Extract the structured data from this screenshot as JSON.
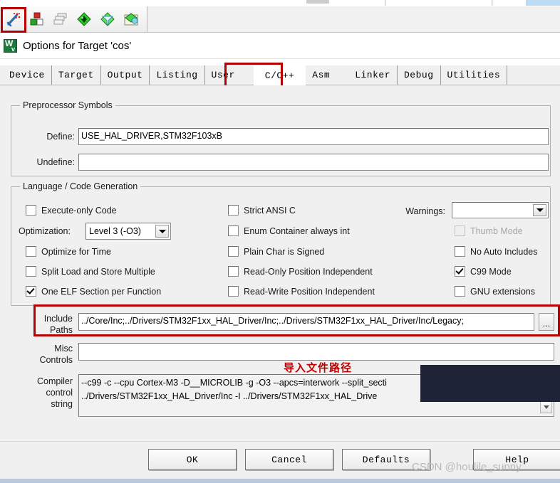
{
  "toolbar": {
    "buttons": [
      {
        "name": "target-options-magic-wand",
        "title": "Options for Target",
        "enabled": true
      },
      {
        "name": "build-target",
        "title": "Build",
        "enabled": true
      },
      {
        "name": "batch-build",
        "title": "Batch Build",
        "enabled": false
      },
      {
        "name": "manage-project-items",
        "title": "Manage Project Items",
        "enabled": true
      },
      {
        "name": "configuration-wizard",
        "title": "Configuration Wizard",
        "enabled": true
      },
      {
        "name": "pack-installer",
        "title": "Pack Installer",
        "enabled": true
      }
    ]
  },
  "dialog": {
    "title": "Options for Target 'cos'",
    "icon": "keil-uvision-icon"
  },
  "tabs": [
    {
      "label": "Device",
      "active": false
    },
    {
      "label": "Target",
      "active": false
    },
    {
      "label": "Output",
      "active": false
    },
    {
      "label": "Listing",
      "active": false
    },
    {
      "label": "User",
      "active": false
    },
    {
      "label": "C/C++",
      "active": true
    },
    {
      "label": "Asm",
      "active": false
    },
    {
      "label": "Linker",
      "active": false
    },
    {
      "label": "Debug",
      "active": false
    },
    {
      "label": "Utilities",
      "active": false
    }
  ],
  "preprocessor": {
    "group_label": "Preprocessor Symbols",
    "define_label": "Define:",
    "define_value": "USE_HAL_DRIVER,STM32F103xB",
    "undefine_label": "Undefine:",
    "undefine_value": ""
  },
  "language": {
    "group_label": "Language / Code Generation",
    "left_column": [
      {
        "label": "Execute-only Code",
        "checked": false,
        "disabled": false
      },
      {
        "label": "Optimize for Time",
        "checked": false,
        "disabled": false
      },
      {
        "label": "Split Load and Store Multiple",
        "checked": false,
        "disabled": false
      },
      {
        "label": "One ELF Section per Function",
        "checked": true,
        "disabled": false
      }
    ],
    "optimization_label": "Optimization:",
    "optimization_value": "Level 3 (-O3)",
    "middle_column": [
      {
        "label": "Strict ANSI C",
        "checked": false,
        "disabled": false
      },
      {
        "label": "Enum Container always int",
        "checked": false,
        "disabled": false
      },
      {
        "label": "Plain Char is Signed",
        "checked": false,
        "disabled": false
      },
      {
        "label": "Read-Only Position Independent",
        "checked": false,
        "disabled": false
      },
      {
        "label": "Read-Write Position Independent",
        "checked": false,
        "disabled": false
      }
    ],
    "warnings_label": "Warnings:",
    "warnings_value": "",
    "right_column": [
      {
        "label": "Thumb Mode",
        "checked": false,
        "disabled": true
      },
      {
        "label": "No Auto Includes",
        "checked": false,
        "disabled": false
      },
      {
        "label": "C99 Mode",
        "checked": true,
        "disabled": false
      },
      {
        "label": "GNU extensions",
        "checked": false,
        "disabled": false
      }
    ]
  },
  "paths": {
    "include_label_line1": "Include",
    "include_label_line2": "Paths",
    "include_value": "../Core/Inc;../Drivers/STM32F1xx_HAL_Driver/Inc;../Drivers/STM32F1xx_HAL_Driver/Inc/Legacy;",
    "browse_button": "...",
    "misc_label_line1": "Misc",
    "misc_label_line2": "Controls",
    "misc_value": "",
    "compiler_label_line1": "Compiler",
    "compiler_label_line2": "control",
    "compiler_label_line3": "string",
    "compiler_value_line1": "--c99 -c --cpu Cortex-M3 -D__MICROLIB -g -O3 --apcs=interwork --split_secti",
    "compiler_value_line2": "../Drivers/STM32F1xx_HAL_Driver/Inc -I ../Drivers/STM32F1xx_HAL_Drive"
  },
  "annotation": {
    "red_note": "导入文件路径"
  },
  "footer": {
    "ok": "OK",
    "cancel": "Cancel",
    "defaults": "Defaults",
    "help": "Help"
  },
  "watermark": "CSDN @houlile_sunny",
  "colors": {
    "highlight": "#b40000",
    "annotation": "#c00000",
    "redaction": "#1e2338",
    "dialog_bg": "#f0f0f0"
  }
}
